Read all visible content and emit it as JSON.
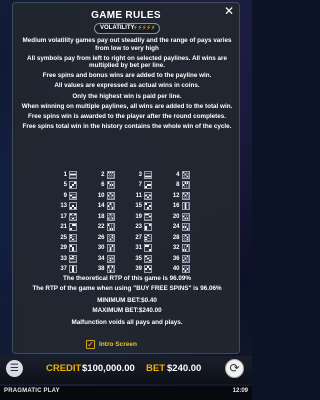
{
  "dialog": {
    "title": "GAME RULES",
    "close_icon": "close-icon",
    "volatility_label": "VOLATILITY",
    "volatility_bolts": "⚡⚡⚡⚡⚡",
    "rules": [
      "Medium volatility games pay out steadily and the range of pays varies from low to very high",
      "All symbols pay from left to right on selected paylines. All wins are multiplied by bet per line.",
      "Free spins and bonus wins are added to the payline win.",
      "All values are expressed as actual wins in coins.",
      "Only the highest win is paid per line.",
      "When winning on multiple paylines, all wins are added to the total win.",
      "Free spins win is awarded to the player after the round completes.",
      "Free spins total win in the history contains the whole win of the cycle."
    ],
    "paylines": [
      {
        "n": "1",
        "cells": [
          0,
          0,
          0,
          1,
          1,
          1,
          0,
          0,
          0
        ]
      },
      {
        "n": "2",
        "cells": [
          1,
          1,
          1,
          0,
          0,
          0,
          0,
          0,
          0
        ]
      },
      {
        "n": "3",
        "cells": [
          0,
          0,
          0,
          0,
          0,
          0,
          1,
          1,
          1
        ]
      },
      {
        "n": "4",
        "cells": [
          1,
          0,
          0,
          0,
          1,
          0,
          0,
          0,
          1
        ]
      },
      {
        "n": "5",
        "cells": [
          0,
          0,
          1,
          0,
          1,
          0,
          1,
          0,
          0
        ]
      },
      {
        "n": "6",
        "cells": [
          1,
          0,
          0,
          0,
          1,
          1,
          0,
          0,
          0
        ]
      },
      {
        "n": "7",
        "cells": [
          0,
          0,
          0,
          0,
          1,
          1,
          1,
          0,
          0
        ]
      },
      {
        "n": "8",
        "cells": [
          0,
          1,
          1,
          1,
          0,
          0,
          0,
          0,
          0
        ]
      },
      {
        "n": "9",
        "cells": [
          0,
          0,
          0,
          1,
          0,
          0,
          0,
          1,
          1
        ]
      },
      {
        "n": "10",
        "cells": [
          0,
          1,
          0,
          1,
          0,
          1,
          0,
          0,
          0
        ]
      },
      {
        "n": "11",
        "cells": [
          0,
          0,
          0,
          1,
          0,
          1,
          0,
          1,
          0
        ]
      },
      {
        "n": "12",
        "cells": [
          1,
          0,
          1,
          0,
          1,
          0,
          0,
          0,
          0
        ]
      },
      {
        "n": "13",
        "cells": [
          0,
          0,
          0,
          0,
          1,
          0,
          1,
          0,
          1
        ]
      },
      {
        "n": "14",
        "cells": [
          0,
          1,
          0,
          1,
          0,
          0,
          0,
          0,
          1
        ]
      },
      {
        "n": "15",
        "cells": [
          1,
          0,
          0,
          0,
          0,
          1,
          0,
          1,
          0
        ]
      },
      {
        "n": "16",
        "cells": [
          0,
          1,
          0,
          0,
          1,
          0,
          0,
          1,
          0
        ]
      },
      {
        "n": "17",
        "cells": [
          1,
          0,
          1,
          0,
          0,
          0,
          0,
          1,
          0
        ]
      },
      {
        "n": "18",
        "cells": [
          0,
          1,
          0,
          0,
          0,
          0,
          1,
          0,
          1
        ]
      },
      {
        "n": "19",
        "cells": [
          1,
          1,
          0,
          0,
          0,
          1,
          0,
          0,
          0
        ]
      },
      {
        "n": "20",
        "cells": [
          0,
          0,
          0,
          1,
          0,
          0,
          0,
          1,
          1
        ]
      },
      {
        "n": "21",
        "cells": [
          0,
          1,
          1,
          0,
          0,
          0,
          1,
          0,
          0
        ]
      },
      {
        "n": "22",
        "cells": [
          1,
          0,
          0,
          0,
          0,
          0,
          0,
          1,
          1
        ]
      },
      {
        "n": "23",
        "cells": [
          0,
          0,
          1,
          1,
          0,
          0,
          1,
          0,
          0
        ]
      },
      {
        "n": "24",
        "cells": [
          0,
          0,
          0,
          1,
          1,
          0,
          0,
          0,
          1
        ]
      },
      {
        "n": "25",
        "cells": [
          1,
          0,
          0,
          1,
          0,
          0,
          0,
          1,
          0
        ]
      },
      {
        "n": "26",
        "cells": [
          0,
          0,
          1,
          0,
          0,
          1,
          0,
          1,
          0
        ]
      },
      {
        "n": "27",
        "cells": [
          0,
          1,
          0,
          1,
          0,
          0,
          1,
          0,
          0
        ]
      },
      {
        "n": "28",
        "cells": [
          0,
          1,
          0,
          0,
          0,
          1,
          0,
          0,
          1
        ]
      },
      {
        "n": "29",
        "cells": [
          1,
          0,
          0,
          0,
          1,
          0,
          0,
          1,
          0
        ]
      },
      {
        "n": "30",
        "cells": [
          0,
          0,
          1,
          0,
          1,
          0,
          0,
          1,
          0
        ]
      },
      {
        "n": "31",
        "cells": [
          1,
          1,
          0,
          0,
          0,
          0,
          0,
          0,
          1
        ]
      },
      {
        "n": "32",
        "cells": [
          0,
          0,
          1,
          0,
          0,
          0,
          1,
          1,
          0
        ]
      },
      {
        "n": "33",
        "cells": [
          0,
          1,
          0,
          1,
          1,
          0,
          0,
          0,
          0
        ]
      },
      {
        "n": "34",
        "cells": [
          0,
          0,
          0,
          0,
          1,
          1,
          0,
          1,
          0
        ]
      },
      {
        "n": "35",
        "cells": [
          1,
          0,
          0,
          0,
          1,
          0,
          0,
          0,
          1
        ]
      },
      {
        "n": "36",
        "cells": [
          0,
          0,
          1,
          0,
          1,
          0,
          1,
          0,
          0
        ]
      },
      {
        "n": "37",
        "cells": [
          0,
          1,
          0,
          0,
          1,
          0,
          0,
          1,
          0
        ]
      },
      {
        "n": "38",
        "cells": [
          1,
          0,
          1,
          0,
          0,
          0,
          0,
          1,
          0
        ]
      },
      {
        "n": "39",
        "cells": [
          0,
          1,
          0,
          1,
          0,
          1,
          0,
          0,
          0
        ]
      },
      {
        "n": "40",
        "cells": [
          0,
          0,
          0,
          1,
          0,
          1,
          0,
          1,
          0
        ]
      }
    ],
    "rtp": "The theoretical RTP of this game is 96.09%",
    "rtp_buy": "The RTP of the game when using \"BUY FREE SPINS\" is 96.06%",
    "min_bet": "MINIMUM BET:$0.40",
    "max_bet": "MAXIMUM BET:$240.00",
    "malfunction": "Malfunction voids all pays and plays.",
    "intro_label": "Intro Screen",
    "intro_checked": "✓"
  },
  "bottom_bar": {
    "menu_icon": "hamburger-menu-icon",
    "menu_glyph": "☰",
    "credit_label": "CREDIT",
    "credit_value": "$100,000.00",
    "bet_label": "BET",
    "bet_value": "$240.00",
    "spin_glyph": "⟳"
  },
  "status_bar": {
    "brand": "PRAGMATIC PLAY",
    "time": "12:09"
  }
}
